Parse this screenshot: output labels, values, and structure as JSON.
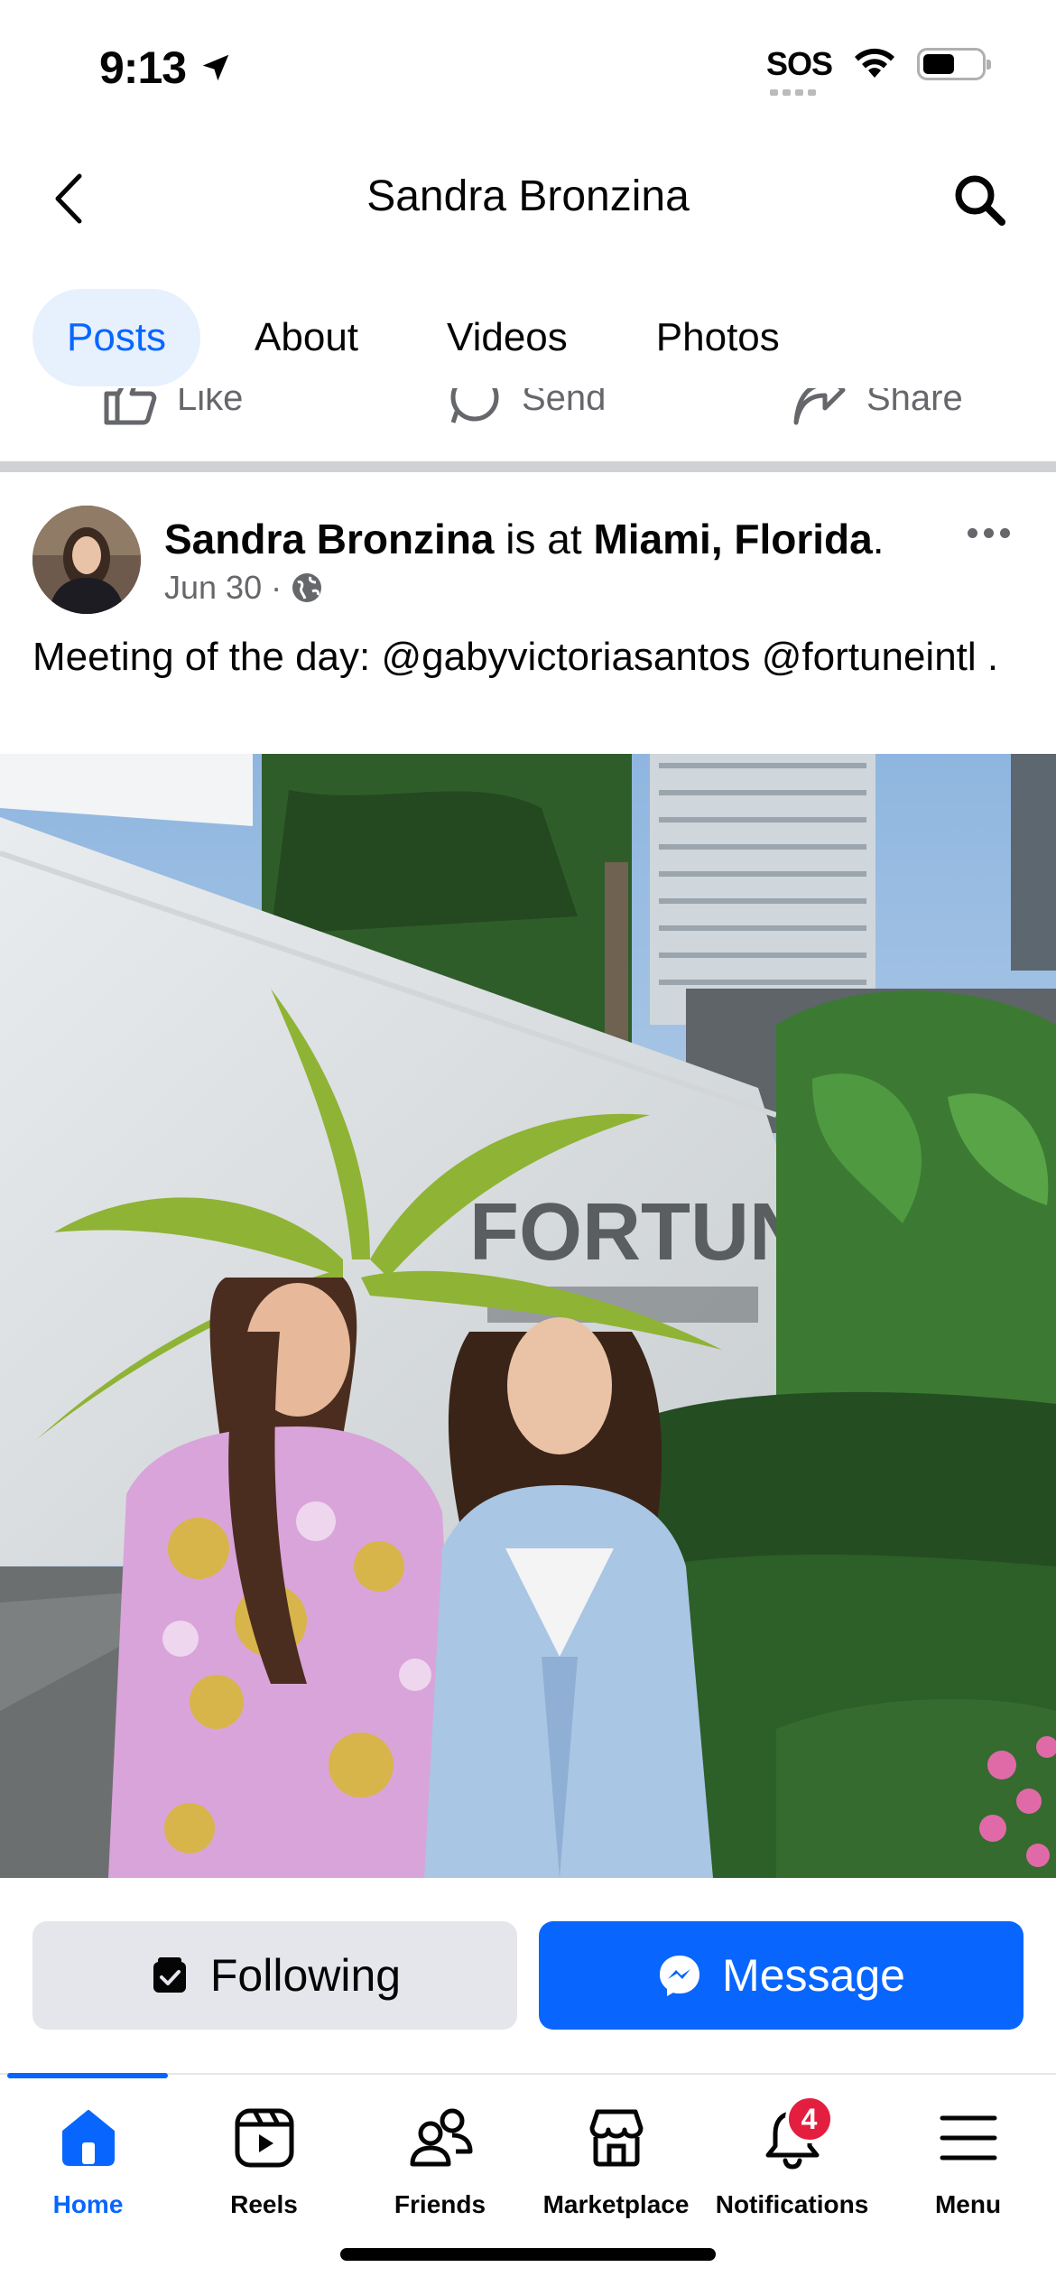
{
  "status_bar": {
    "time": "9:13",
    "sos": "SOS"
  },
  "header": {
    "title": "Sandra Bronzina",
    "back_icon": "chevron-left-icon",
    "search_icon": "search-icon"
  },
  "tabs": [
    {
      "label": "Posts",
      "active": true
    },
    {
      "label": "About",
      "active": false
    },
    {
      "label": "Videos",
      "active": false
    },
    {
      "label": "Photos",
      "active": false
    }
  ],
  "previous_post_actions": {
    "like": "Like",
    "send": "Send",
    "share": "Share"
  },
  "post": {
    "author": "Sandra Bronzina",
    "connector": " is at ",
    "location": "Miami, Florida",
    "suffix": ".",
    "date": "Jun 30",
    "privacy_icon": "globe-icon",
    "text": "Meeting of the day: @gabyvictoriasantos @fortuneintl .",
    "photo_sign": "FORTUNE"
  },
  "actions": {
    "following": "Following",
    "message": "Message"
  },
  "bottom_nav": [
    {
      "label": "Home",
      "icon": "home-icon",
      "active": true
    },
    {
      "label": "Reels",
      "icon": "reels-icon",
      "active": false
    },
    {
      "label": "Friends",
      "icon": "friends-icon",
      "active": false
    },
    {
      "label": "Marketplace",
      "icon": "marketplace-icon",
      "active": false
    },
    {
      "label": "Notifications",
      "icon": "bell-icon",
      "active": false,
      "badge": "4"
    },
    {
      "label": "Menu",
      "icon": "menu-icon",
      "active": false
    }
  ],
  "colors": {
    "accent": "#0866ff",
    "badge": "#e41e3f",
    "secondary_text": "#65676b"
  }
}
